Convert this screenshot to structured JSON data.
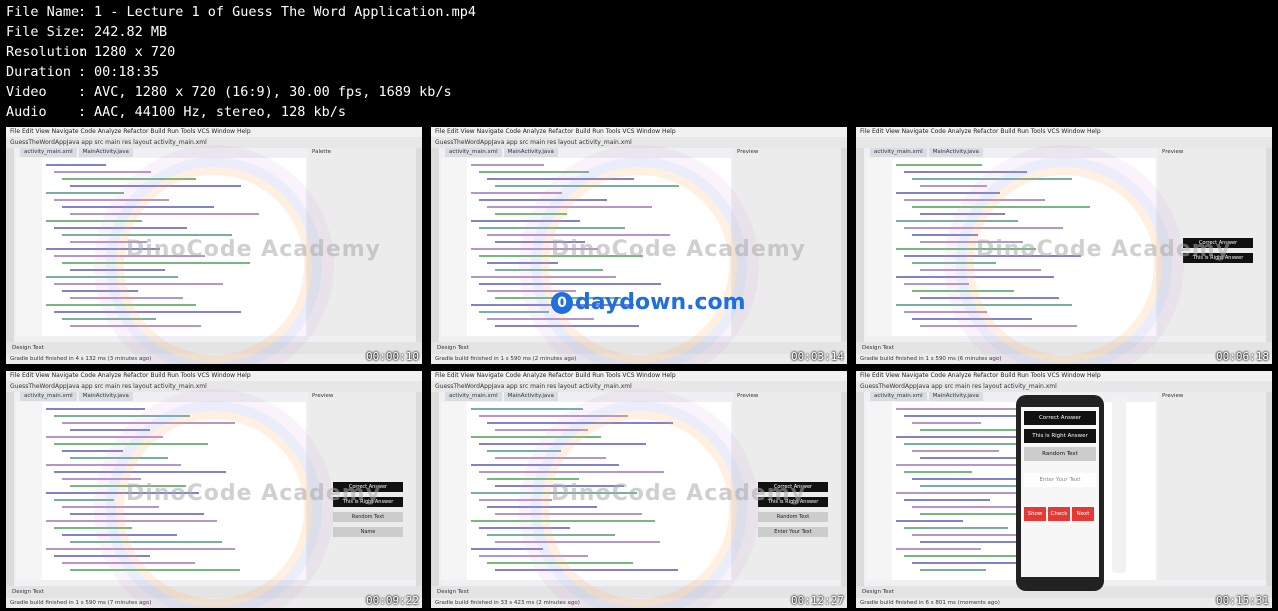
{
  "info": [
    {
      "key": "File Name",
      "value": "1 - Lecture 1 of Guess The Word Application.mp4"
    },
    {
      "key": "File Size",
      "value": "242.82 MB"
    },
    {
      "key": "Resolution",
      "value": "1280 x 720"
    },
    {
      "key": "Duration",
      "value": "00:18:35"
    },
    {
      "key": "Video",
      "value": "AVC, 1280 x 720 (16:9), 30.00 fps, 1689 kb/s"
    },
    {
      "key": "Audio",
      "value": "AAC, 44100 Hz, stereo, 128 kb/s"
    }
  ],
  "menu": "File  Edit  View  Navigate  Code  Analyze  Refactor  Build  Run  Tools  VCS  Window  Help",
  "tiles": [
    {
      "timestamp": "00:00:10",
      "breadcrumb": "GuessTheWordAppJava  app  src  main  res  layout  activity_main.xml",
      "tabs": [
        "activity_main.xml",
        "MainActivity.java"
      ],
      "bottom_tabs": "Design   Text",
      "status": "Gradle build finished in 4 s 132 ms (3 minutes ago)",
      "preview": "Palette",
      "watermark": "DinoCode Academy"
    },
    {
      "timestamp": "00:03:14",
      "breadcrumb": "GuessTheWordAppJava  app  src  main  res  layout  activity_main.xml",
      "tabs": [
        "activity_main.xml",
        "MainActivity.java"
      ],
      "bottom_tabs": "Design   Text",
      "status": "Gradle build finished in 1 s 590 ms (2 minutes ago)",
      "preview": "Preview",
      "watermark": "DinoCode Academy",
      "site": "daydown.com"
    },
    {
      "timestamp": "00:06:18",
      "breadcrumb": "",
      "tabs": [
        "activity_main.xml",
        "MainActivity.java"
      ],
      "bottom_tabs": "Design   Text",
      "status": "Gradle build finished in 1 s 590 ms (6 minutes ago)",
      "preview": "Preview",
      "watermark": "DinoCode Academy",
      "cards": [
        "Correct Answer",
        "This is Right Answer"
      ]
    },
    {
      "timestamp": "00:09:22",
      "breadcrumb": "GuessTheWordAppJava  app  src  main  res  layout  activity_main.xml",
      "tabs": [
        "activity_main.xml",
        "MainActivity.java"
      ],
      "bottom_tabs": "Design   Text",
      "status": "Gradle build finished in 1 s 590 ms (7 minutes ago)",
      "preview": "Preview",
      "watermark": "DinoCode Academy",
      "cards": [
        "Correct Answer",
        "This is Right Answer",
        "Random Text",
        "Name"
      ]
    },
    {
      "timestamp": "00:12:27",
      "breadcrumb": "GuessTheWordAppJava  app  src  main  res  layout  activity_main.xml",
      "tabs": [
        "activity_main.xml",
        "MainActivity.java"
      ],
      "bottom_tabs": "Design   Text",
      "status": "Gradle build finished in 33 s 423 ms (2 minutes ago)",
      "preview": "Preview",
      "watermark": "DinoCode Academy",
      "cards": [
        "Correct Answer",
        "This is Right Answer",
        "Random Text",
        "Enter Your Text"
      ]
    },
    {
      "timestamp": "00:15:31",
      "breadcrumb": "GuessTheWordAppJava  app  src  main  res  layout  activity_main.xml",
      "tabs": [
        "activity_main.xml",
        "MainActivity.java"
      ],
      "bottom_tabs": "Design   Text",
      "status": "Gradle build finished in 6 s 801 ms (moments ago)",
      "preview": "Preview",
      "watermark": "",
      "emulator": {
        "title": "Correct Answer",
        "answer": "This is Right Answer",
        "random": "Random Text",
        "input": "Enter Your Text",
        "buttons": [
          "Show",
          "Check",
          "Next"
        ]
      },
      "cards": [
        "Correct Answer",
        "This is Right Answer",
        "Random Text",
        "Enter Your Text"
      ]
    }
  ]
}
